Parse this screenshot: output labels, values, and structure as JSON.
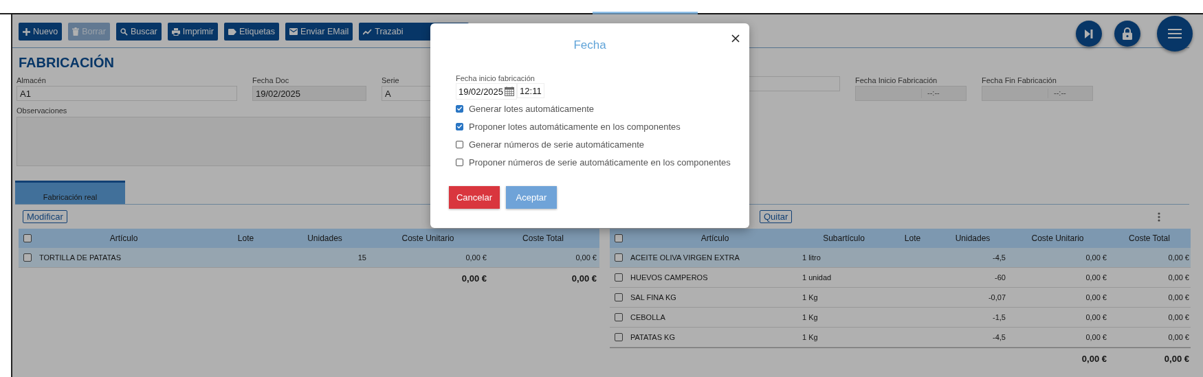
{
  "toolbar": {
    "buttons": [
      {
        "label": "Nuevo",
        "kind": "plus",
        "disabled": false
      },
      {
        "label": "Borrar",
        "kind": "trash",
        "disabled": true
      },
      {
        "label": "Buscar",
        "kind": "search",
        "disabled": false
      },
      {
        "label": "Imprimir",
        "kind": "print",
        "disabled": false
      },
      {
        "label": "Etiquetas",
        "kind": "tag",
        "disabled": false
      },
      {
        "label": "Enviar EMail",
        "kind": "mail",
        "disabled": false
      },
      {
        "label": "Trazabi",
        "kind": "trend",
        "disabled": false
      }
    ]
  },
  "page_title": "FABRICACIÓN",
  "fields": [
    {
      "label": "Almacén",
      "value": "A1",
      "readonly": false
    },
    {
      "label": "Fecha Doc",
      "value": "19/02/2025",
      "readonly": true
    },
    {
      "label": "Serie",
      "value": "A",
      "readonly": false
    }
  ],
  "date_fields": [
    {
      "label": "Fecha Inicio Fabricación",
      "placeholder": "--:--"
    },
    {
      "label": "Fecha Fin Fabricación",
      "placeholder": "--:--"
    }
  ],
  "notes": {
    "label": "Observaciones"
  },
  "tabs": [
    {
      "label": "Fabricación real",
      "selected": true
    }
  ],
  "left_table": {
    "buttons": [
      "Modificar"
    ],
    "all_checked": false,
    "columns": [
      "Artículo",
      "Lote",
      "Unidades",
      "Coste Unitario",
      "Coste Total"
    ],
    "rows": [
      {
        "checked": false,
        "selected": true,
        "cells": [
          "TORTILLA DE PATATAS",
          "",
          "15",
          "0,00 €",
          "0,00 €"
        ]
      }
    ],
    "totals": [
      "0,00 €",
      "0,00 €"
    ]
  },
  "right_table": {
    "buttons": [
      "Quitar"
    ],
    "all_checked": false,
    "columns": [
      "Artículo",
      "Subartículo",
      "Lote",
      "Unidades",
      "Coste Unitario",
      "Coste Total"
    ],
    "rows": [
      {
        "checked": false,
        "selected": true,
        "cells": [
          "ACEITE OLIVA VIRGEN EXTRA",
          "1 litro",
          "",
          "-4,5",
          "0,00 €",
          "0,00 €"
        ]
      },
      {
        "checked": false,
        "selected": false,
        "cells": [
          "HUEVOS CAMPEROS",
          "1 unidad",
          "",
          "-60",
          "0,00 €",
          "0,00 €"
        ]
      },
      {
        "checked": false,
        "selected": false,
        "cells": [
          "SAL FINA KG",
          "1 Kg",
          "",
          "-0,07",
          "0,00 €",
          "0,00 €"
        ]
      },
      {
        "checked": false,
        "selected": false,
        "cells": [
          "CEBOLLA",
          "1 Kg",
          "",
          "-1,5",
          "0,00 €",
          "0,00 €"
        ]
      },
      {
        "checked": false,
        "selected": false,
        "cells": [
          "PATATAS KG",
          "1 Kg",
          "",
          "-4,5",
          "0,00 €",
          "0,00 €"
        ]
      }
    ],
    "totals": [
      "0,00 €",
      "0,00 €"
    ]
  },
  "dialog": {
    "title": "Fecha",
    "date_label": "Fecha inicio fabricación",
    "date": "19/02/2025",
    "time": "12:11",
    "options": [
      {
        "label": "Generar lotes automáticamente",
        "checked": true
      },
      {
        "label": "Proponer lotes automáticamente en los componentes",
        "checked": true
      },
      {
        "label": "Generar números de serie automáticamente",
        "checked": false
      },
      {
        "label": "Proponer números de serie automáticamente en los componentes",
        "checked": false
      }
    ],
    "buttons": [
      {
        "label": "Cancelar",
        "kind": "cancel"
      },
      {
        "label": "Aceptar",
        "kind": "accept"
      }
    ]
  }
}
